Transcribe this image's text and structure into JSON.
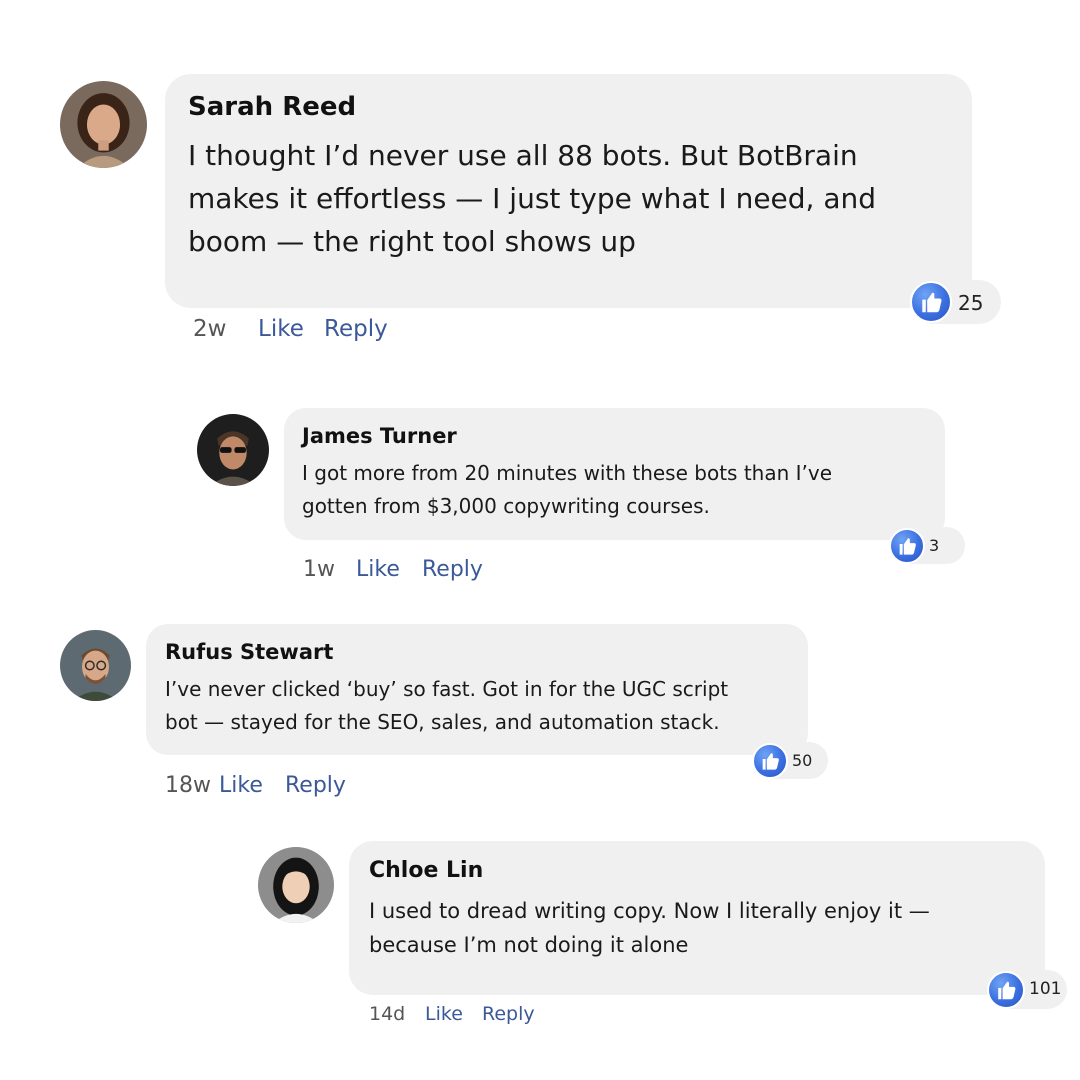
{
  "comments": [
    {
      "author": "Sarah Reed",
      "text": "I thought I’d never use all 88 bots. But BotBrain makes it effortless — I just type what I need, and boom — the right tool shows up",
      "time": "2w",
      "like_label": "Like",
      "reply_label": "Reply",
      "reaction_icon": "thumbs-up-icon",
      "reaction_count": "25"
    },
    {
      "author": "James Turner",
      "text": "I got more from 20 minutes with these bots than I’ve gotten from $3,000 copywriting courses.",
      "time": "1w",
      "like_label": "Like",
      "reply_label": "Reply",
      "reaction_icon": "thumbs-up-icon",
      "reaction_count": "3"
    },
    {
      "author": "Rufus Stewart",
      "text": "I’ve never clicked ‘buy’ so fast. Got in for the UGC script bot — stayed for the SEO, sales, and automation stack.",
      "time": "18w",
      "like_label": "Like",
      "reply_label": "Reply",
      "reaction_icon": "thumbs-up-icon",
      "reaction_count": "50"
    },
    {
      "author": "Chloe Lin",
      "text": "I used to dread writing copy. Now I literally enjoy it — because I’m not doing it alone",
      "time": "14d",
      "like_label": "Like",
      "reply_label": "Reply",
      "reaction_icon": "thumbs-up-icon",
      "reaction_count": "101"
    }
  ],
  "colors": {
    "bubble": "#f0f0f0",
    "action_link": "#3b5998",
    "like_badge": "#3b6fe0"
  }
}
